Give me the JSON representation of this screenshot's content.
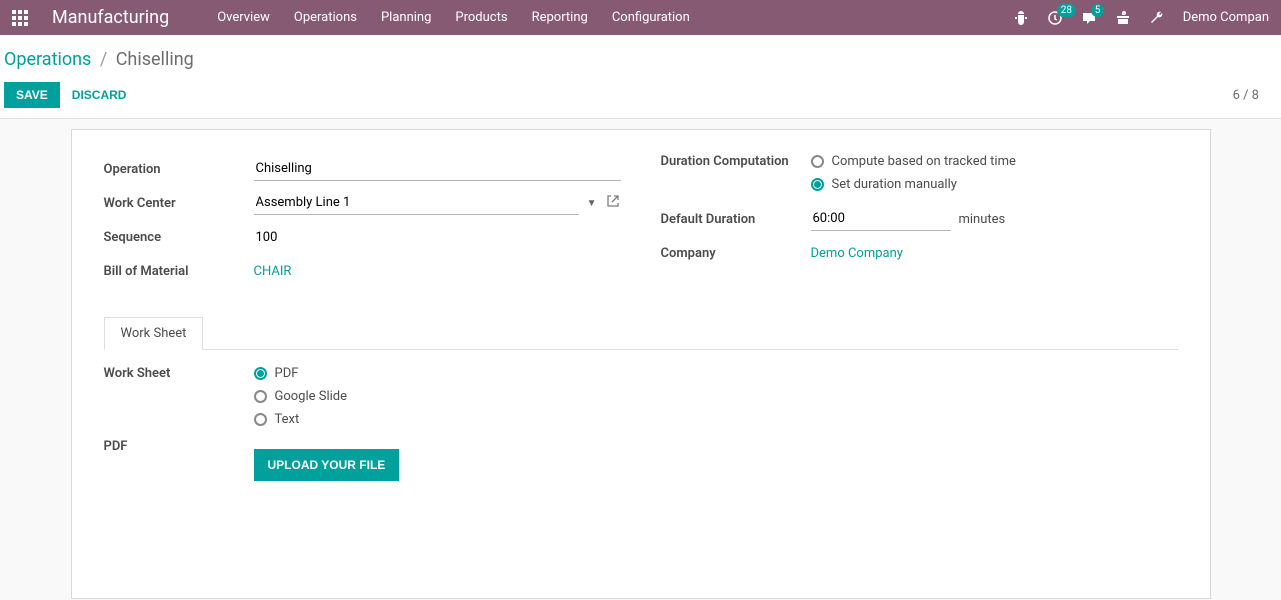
{
  "topbar": {
    "brand": "Manufacturing",
    "nav": [
      "Overview",
      "Operations",
      "Planning",
      "Products",
      "Reporting",
      "Configuration"
    ],
    "clock_badge": "28",
    "chat_badge": "5",
    "company": "Demo Compan"
  },
  "breadcrumb": {
    "parent": "Operations",
    "current": "Chiselling"
  },
  "actions": {
    "save": "SAVE",
    "discard": "DISCARD",
    "pager": "6 / 8"
  },
  "form": {
    "labels": {
      "operation": "Operation",
      "work_center": "Work Center",
      "sequence": "Sequence",
      "bom": "Bill of Material",
      "duration_comp": "Duration Computation",
      "default_duration": "Default Duration",
      "company": "Company",
      "minutes": "minutes"
    },
    "values": {
      "operation": "Chiselling",
      "work_center": "Assembly Line 1",
      "sequence": "100",
      "bom": "CHAIR",
      "duration_opts": {
        "tracked": "Compute based on tracked time",
        "manual": "Set duration manually"
      },
      "default_duration": "60:00",
      "company": "Demo Company"
    }
  },
  "tabs": {
    "worksheet": "Work Sheet"
  },
  "worksheet": {
    "label": "Work Sheet",
    "pdf_label": "PDF",
    "options": {
      "pdf": "PDF",
      "gslide": "Google Slide",
      "text": "Text"
    },
    "upload": "UPLOAD YOUR FILE"
  }
}
